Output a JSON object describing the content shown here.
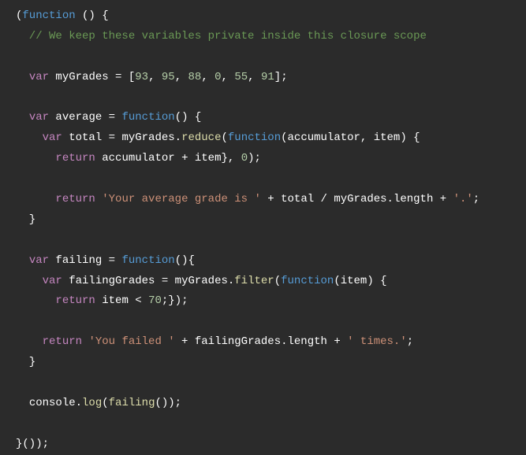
{
  "code": {
    "line1_open_paren": "(",
    "line1_function": "function",
    "line1_space_paren": " ()",
    "line1_brace": " {",
    "line2_comment": "  // We keep these variables private inside this closure scope",
    "line4_indent": "  ",
    "line4_var": "var",
    "line4_name": " myGrades ",
    "line4_eq": "=",
    "line4_bracket": " [",
    "line4_n1": "93",
    "line4_c1": ", ",
    "line4_n2": "95",
    "line4_c2": ", ",
    "line4_n3": "88",
    "line4_c3": ", ",
    "line4_n4": "0",
    "line4_c4": ", ",
    "line4_n5": "55",
    "line4_c5": ", ",
    "line4_n6": "91",
    "line4_close": "];",
    "line6_indent": "  ",
    "line6_var": "var",
    "line6_name": " average ",
    "line6_eq": "=",
    "line6_space": " ",
    "line6_function": "function",
    "line6_paren": "()",
    "line6_brace": " {",
    "line7_indent": "    ",
    "line7_var": "var",
    "line7_name": " total ",
    "line7_eq": "=",
    "line7_space": " myGrades.",
    "line7_reduce": "reduce",
    "line7_open": "(",
    "line7_function": "function",
    "line7_args": "(accumulator, item)",
    "line7_brace": " {",
    "line8_indent": "      ",
    "line8_return": "return",
    "line8_expr": " accumulator ",
    "line8_plus": "+",
    "line8_item": " item}",
    "line8_comma": ", ",
    "line8_zero": "0",
    "line8_close": ");",
    "line10_indent": "      ",
    "line10_return": "return",
    "line10_space": " ",
    "line10_str1": "'Your average grade is '",
    "line10_plus1": " + ",
    "line10_total": "total ",
    "line10_div": "/",
    "line10_len": " myGrades.length ",
    "line10_plus2": "+",
    "line10_space2": " ",
    "line10_str2": "'.'",
    "line10_semi": ";",
    "line11_close": "  }",
    "line13_indent": "  ",
    "line13_var": "var",
    "line13_name": " failing ",
    "line13_eq": "=",
    "line13_space": " ",
    "line13_function": "function",
    "line13_paren": "()",
    "line13_brace": "{",
    "line14_indent": "    ",
    "line14_var": "var",
    "line14_name": " failingGrades ",
    "line14_eq": "=",
    "line14_space": " myGrades.",
    "line14_filter": "filter",
    "line14_open": "(",
    "line14_function": "function",
    "line14_args": "(item)",
    "line14_brace": " {",
    "line15_indent": "      ",
    "line15_return": "return",
    "line15_item": " item ",
    "line15_lt": "<",
    "line15_space": " ",
    "line15_seventy": "70",
    "line15_close": ";});",
    "line17_indent": "    ",
    "line17_return": "return",
    "line17_space": " ",
    "line17_str1": "'You failed '",
    "line17_plus1": " + ",
    "line17_expr": "failingGrades.length ",
    "line17_plus2": "+",
    "line17_space2": " ",
    "line17_str2": "' times.'",
    "line17_semi": ";",
    "line18_close": "  }",
    "line20_indent": "  ",
    "line20_console": "console.",
    "line20_log": "log",
    "line20_open": "(",
    "line20_call": "failing",
    "line20_paren": "()",
    "line20_close": ");",
    "line22_close": "}());"
  }
}
